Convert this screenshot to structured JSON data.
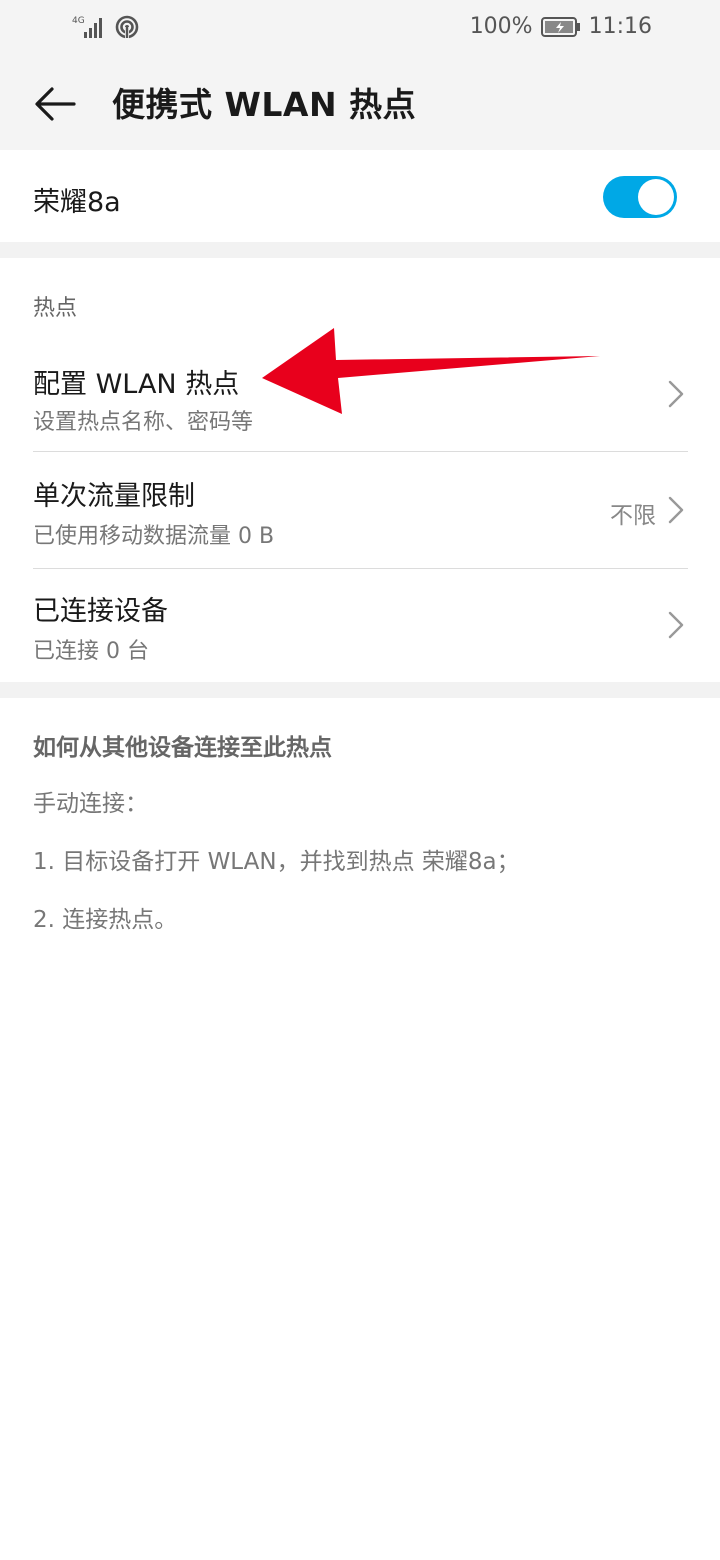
{
  "status_bar": {
    "network_label": "4G",
    "battery_percent": "100%",
    "time": "11:16",
    "icons": [
      "signal-icon",
      "hotspot-icon",
      "battery-charging-icon"
    ]
  },
  "app_bar": {
    "title": "便携式 WLAN 热点",
    "back_icon": "back-arrow-icon"
  },
  "hotspot": {
    "name": "荣耀8a",
    "enabled": true
  },
  "section": {
    "label": "热点",
    "items": [
      {
        "title": "配置 WLAN 热点",
        "subtitle": "设置热点名称、密码等",
        "value": ""
      },
      {
        "title": "单次流量限制",
        "subtitle": "已使用移动数据流量 0 B",
        "value": "不限"
      },
      {
        "title": "已连接设备",
        "subtitle": "已连接 0 台",
        "value": ""
      }
    ]
  },
  "help": {
    "title": "如何从其他设备连接至此热点",
    "lines": [
      "手动连接：",
      "1. 目标设备打开 WLAN，并找到热点 荣耀8a；",
      "2. 连接热点。"
    ]
  },
  "colors": {
    "accent": "#00a8e6",
    "annotation_arrow": "#e8001c"
  }
}
